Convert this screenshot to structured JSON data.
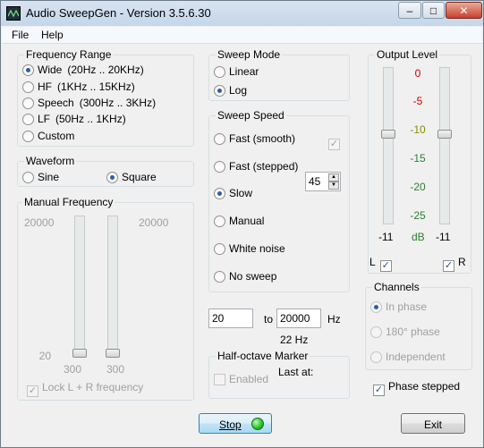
{
  "window": {
    "title": "Audio SweepGen - Version 3.5.6.30"
  },
  "titlebar_buttons": {
    "minimize": "–",
    "maximize": "□",
    "close": "✕"
  },
  "menu": [
    "File",
    "Help"
  ],
  "frequency_range": {
    "title": "Frequency Range",
    "options": [
      {
        "label": "Wide",
        "range": "(20Hz .. 20KHz)",
        "selected": true
      },
      {
        "label": "HF",
        "range": "(1KHz .. 15KHz)",
        "selected": false
      },
      {
        "label": "Speech",
        "range": "(300Hz .. 3KHz)",
        "selected": false
      },
      {
        "label": "LF",
        "range": "(50Hz .. 1KHz)",
        "selected": false
      },
      {
        "label": "Custom",
        "range": "",
        "selected": false
      }
    ]
  },
  "waveform": {
    "title": "Waveform",
    "options": [
      {
        "label": "Sine",
        "selected": false
      },
      {
        "label": "Square",
        "selected": true
      }
    ]
  },
  "manual_frequency": {
    "title": "Manual Frequency",
    "left_max": "20000",
    "right_max": "20000",
    "left_min": "20",
    "left_bottom": "300",
    "right_bottom": "300",
    "lock_label": "Lock L + R frequency",
    "lock_checked": true,
    "enabled": false
  },
  "sweep_mode": {
    "title": "Sweep Mode",
    "options": [
      {
        "label": "Linear",
        "selected": false
      },
      {
        "label": "Log",
        "selected": true
      }
    ]
  },
  "sweep_speed": {
    "title": "Sweep Speed",
    "options": [
      {
        "label": "Fast (smooth)",
        "selected": false
      },
      {
        "label": "Fast (stepped)",
        "selected": false
      },
      {
        "label": "Slow",
        "selected": true
      },
      {
        "label": "Manual",
        "selected": false
      },
      {
        "label": "White noise",
        "selected": false
      },
      {
        "label": "No sweep",
        "selected": false
      }
    ],
    "smooth_checkbox_checked": true,
    "spin_value": "45"
  },
  "sweep_range": {
    "from": "20",
    "to_label": "to",
    "to": "20000",
    "unit": "Hz",
    "current": "22 Hz"
  },
  "half_octave": {
    "title": "Half-octave Marker",
    "enabled_label": "Enabled",
    "enabled_checked": false,
    "last_at_label": "Last at:"
  },
  "output_level": {
    "title": "Output Level",
    "scale": [
      "0",
      "-5",
      "-10",
      "-15",
      "-20",
      "-25"
    ],
    "scale_colors": [
      "#cc0000",
      "#cc0000",
      "#8a8a00",
      "#2e7d32",
      "#2e7d32",
      "#2e7d32"
    ],
    "unit": "dB",
    "unit_color": "#2e7d32",
    "left_value": "-11",
    "right_value": "-11",
    "left_label": "L",
    "right_label": "R",
    "left_checked": true,
    "right_checked": true
  },
  "channels": {
    "title": "Channels",
    "options": [
      {
        "label": "In phase",
        "selected": true
      },
      {
        "label": "180° phase",
        "selected": false
      },
      {
        "label": "Independent",
        "selected": false
      }
    ],
    "enabled": false
  },
  "phase_stepped": {
    "label": "Phase stepped",
    "checked": true
  },
  "buttons": {
    "stop": "Stop",
    "exit": "Exit",
    "stop_indicator_color": "#21c321"
  }
}
